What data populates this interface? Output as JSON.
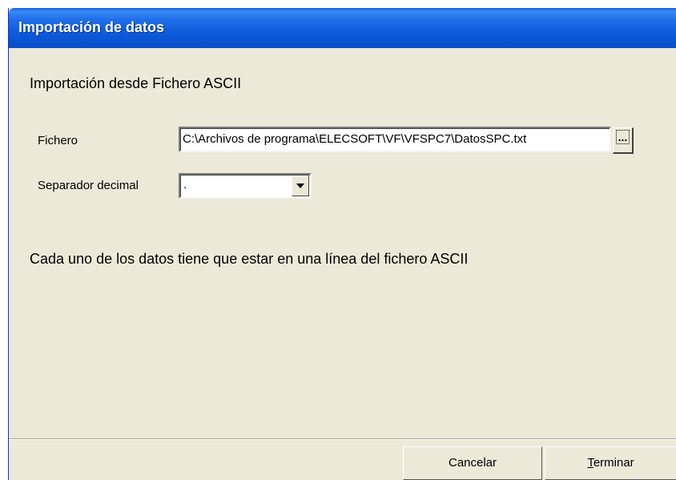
{
  "window": {
    "title": "Importación de datos"
  },
  "dialog": {
    "heading": "Importación desde Fichero ASCII",
    "file": {
      "label": "Fichero",
      "value": "C:\\Archivos de programa\\ELECSOFT\\VF\\VFSPC7\\DatosSPC.txt",
      "browse_label": "..."
    },
    "decimal_separator": {
      "label": "Separador decimal",
      "selected": "."
    },
    "info_text": "Cada uno de los datos tiene que estar en una línea del fichero ASCII"
  },
  "buttons": {
    "cancel_label": "Cancelar",
    "finish_label": "Terminar"
  },
  "colors": {
    "titlebar": "#0a5fe0",
    "dialog_background": "#ece9d8"
  }
}
